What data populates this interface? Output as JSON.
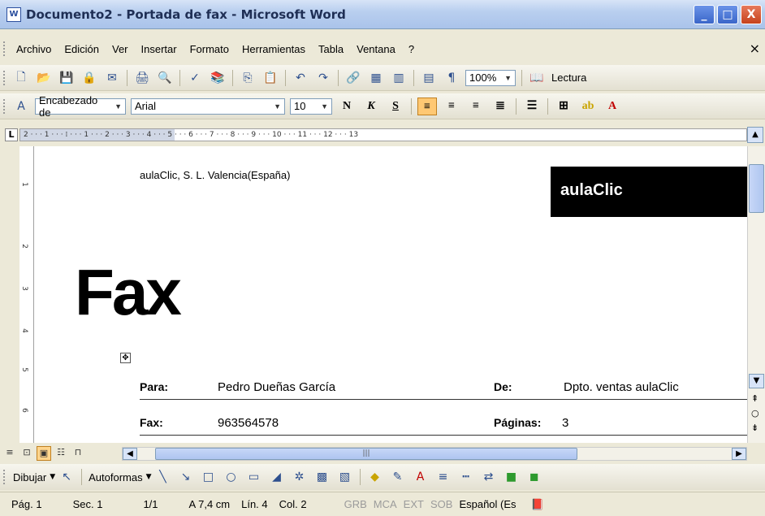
{
  "window": {
    "title": "Documento2 - Portada de fax - Microsoft Word",
    "buttons": [
      "_",
      "□",
      "X"
    ]
  },
  "menubar": {
    "items": [
      "Archivo",
      "Edición",
      "Ver",
      "Insertar",
      "Formato",
      "Herramientas",
      "Tabla",
      "Ventana",
      "?"
    ],
    "close": "×"
  },
  "standard_toolbar": {
    "zoom": "100%",
    "lectura_label": "Lectura"
  },
  "format_toolbar": {
    "style": "Encabezado de",
    "font": "Arial",
    "size": "10",
    "bold": "N",
    "italic": "K",
    "underline": "S"
  },
  "ruler": {
    "marks": "2 · · · 1 · · · ⁞ · · · 1 · · · 2 · · · 3 · · · 4 · · · 5 · · · 6 · · · 7 · · · 8 · · · 9 · · · 10 · · · 11 · · · 12 · · · 13"
  },
  "vertical_ruler": {
    "marks": [
      "1",
      "2",
      "3",
      "4",
      "5",
      "6"
    ]
  },
  "document": {
    "company": "aulaClic, S. L. Valencia(España)",
    "logo_text": "aulaClic",
    "title": "Fax",
    "rows": [
      {
        "label1": "Para:",
        "value1": "Pedro Dueñas García",
        "label2": "De:",
        "value2": "Dpto. ventas aulaClic"
      },
      {
        "label1": "Fax:",
        "value1": "963564578",
        "label2": "Páginas:",
        "value2": "3"
      }
    ]
  },
  "drawing_toolbar": {
    "dibujar": "Dibujar",
    "autoformas": "Autoformas"
  },
  "statusbar": {
    "page": "Pág. 1",
    "section": "Sec. 1",
    "pages": "1/1",
    "at": "A 7,4 cm",
    "line": "Lín. 4",
    "col": "Col. 2",
    "grb": "GRB",
    "mca": "MCA",
    "ext": "EXT",
    "sob": "SOB",
    "language": "Español (Es"
  },
  "colors": {
    "titlebar": "#b9cfef",
    "active_button": "#ffc873",
    "logo_bg": "#000000"
  }
}
